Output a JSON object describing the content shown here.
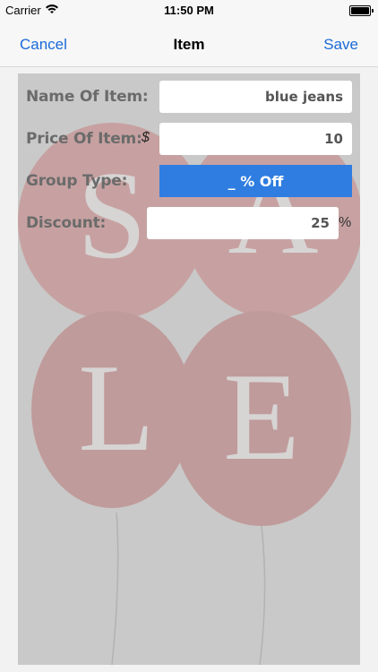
{
  "status_bar": {
    "carrier": "Carrier",
    "time": "11:50 PM"
  },
  "nav": {
    "cancel": "Cancel",
    "title": "Item",
    "save": "Save"
  },
  "form": {
    "name_label": "Name Of Item:",
    "name_value": "blue jeans",
    "price_label": "Price Of Item:",
    "currency_symbol": "$",
    "price_value": "10",
    "group_label": "Group Type:",
    "group_value": "_ % Off",
    "discount_label": "Discount:",
    "discount_value": "25",
    "percent_symbol": "%"
  },
  "background_letters": [
    "S",
    "A",
    "L",
    "E"
  ],
  "colors": {
    "accent": "#1a6ad8",
    "group_button": "#2f7de1",
    "balloon": "#b24848"
  }
}
